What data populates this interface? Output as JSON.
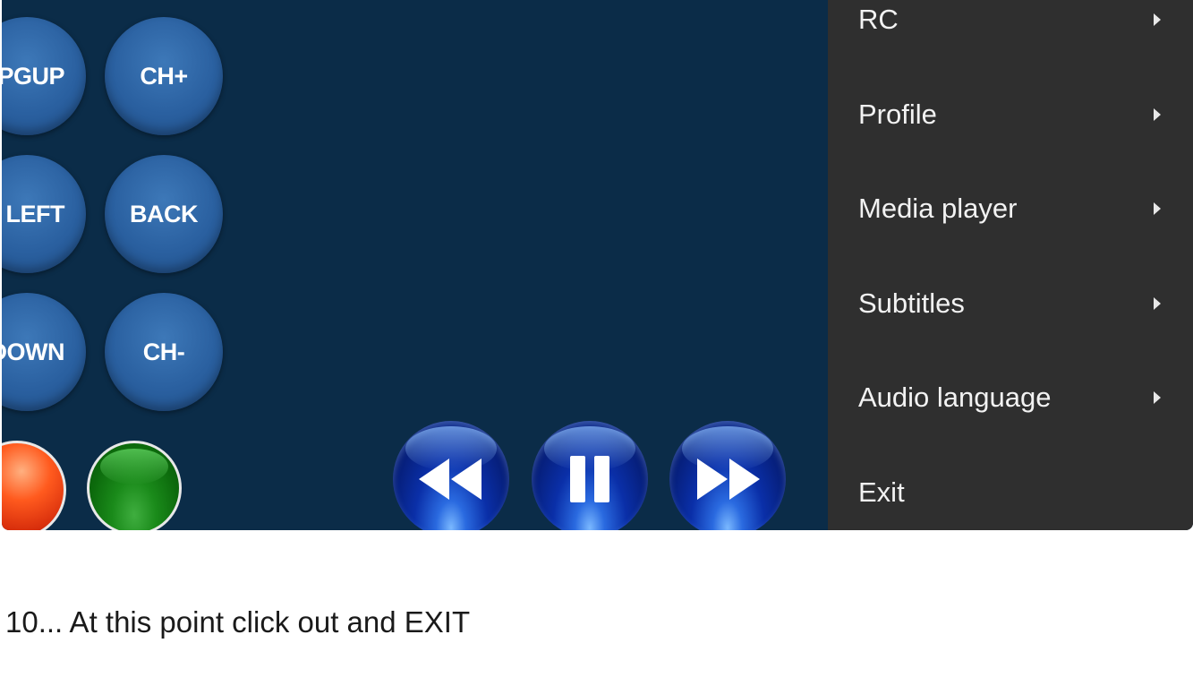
{
  "remote": {
    "buttons": [
      {
        "label": "PGUP"
      },
      {
        "label": "CH+"
      },
      {
        "label": "LEFT"
      },
      {
        "label": "BACK"
      },
      {
        "label": "DOWN"
      },
      {
        "label": "CH-"
      }
    ],
    "color_buttons": [
      "red",
      "green"
    ],
    "media_controls": [
      "rewind",
      "pause",
      "fast-forward"
    ],
    "background_color": "#0b2c48"
  },
  "menu": {
    "background_color": "#2f2f2f",
    "items": [
      {
        "label": "RC",
        "has_submenu": true
      },
      {
        "label": "Profile",
        "has_submenu": true
      },
      {
        "label": "Media player",
        "has_submenu": true
      },
      {
        "label": "Subtitles",
        "has_submenu": true
      },
      {
        "label": "Audio language",
        "has_submenu": true
      },
      {
        "label": "Exit",
        "has_submenu": false
      }
    ]
  },
  "caption": "10... At this point click out and EXIT"
}
